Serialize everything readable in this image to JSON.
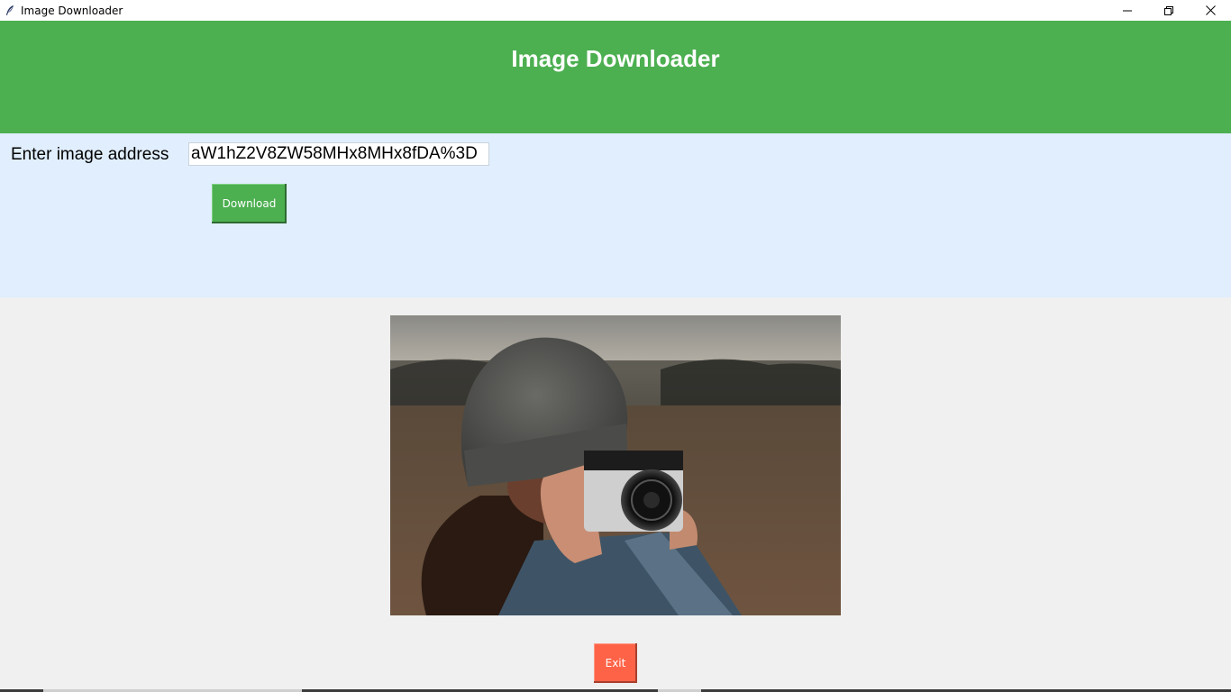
{
  "window": {
    "title": "Image Downloader",
    "controls": {
      "minimize_glyph": "—",
      "restore_glyph": "❐",
      "close_glyph": "✕"
    }
  },
  "header": {
    "title": "Image Downloader"
  },
  "form": {
    "address_label": "Enter image address",
    "address_value": "aW1hZ2V8ZW58MHx8MHx8fDA%3D",
    "download_label": "Download"
  },
  "preview": {
    "icon": "photo-image"
  },
  "footer": {
    "exit_label": "Exit"
  },
  "colors": {
    "header_bg": "#4caf50",
    "panel_bg": "#e0eefd",
    "download_bg": "#4caf50",
    "exit_bg": "#ff6347",
    "window_bg": "#f0f0f0"
  }
}
